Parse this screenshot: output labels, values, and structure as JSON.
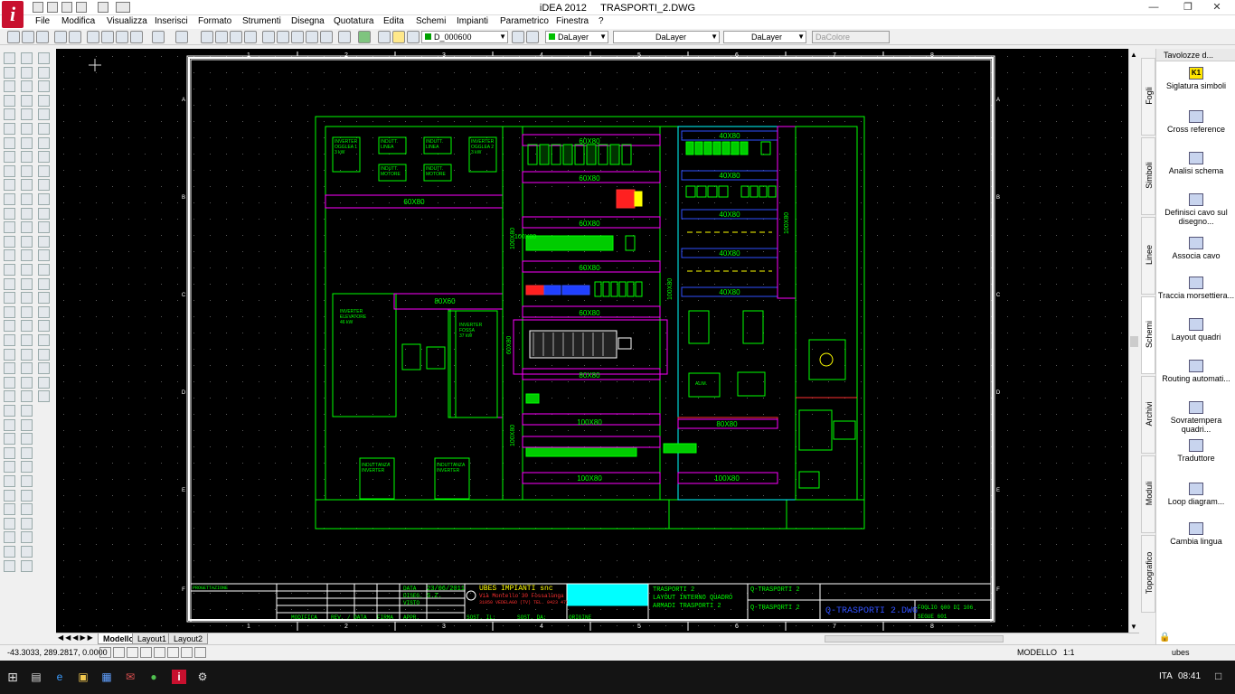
{
  "app": {
    "title": "iDEA 2012",
    "file": "TRASPORTI_2.DWG"
  },
  "menu": [
    "File",
    "Modifica",
    "Visualizza",
    "Inserisci",
    "Formato",
    "Strumenti",
    "Disegna",
    "Quotatura",
    "Edita",
    "Schemi",
    "Impianti",
    "Parametrico",
    "Finestra",
    "?"
  ],
  "toolbar": {
    "layer": "D_000600",
    "color": "DaLayer",
    "linetype": "DaLayer",
    "lineweight": "DaLayer",
    "plotcolor": "DaColore"
  },
  "drawing": {
    "cols": [
      "1",
      "2",
      "3",
      "4",
      "5",
      "6",
      "7",
      "8"
    ],
    "rows": [
      "A",
      "B",
      "C",
      "D",
      "E",
      "F"
    ],
    "left_labels": [
      "INVERTER\nOGGLEA 1\n3 kW",
      "INDUTT.\nLINEA",
      "INDUTT.\nLINEA",
      "INVERTER\nOGGLEA 2\n3 kW",
      "INDUTT.\nMOTORE",
      "INDUTT.\nMOTORE"
    ],
    "plates": [
      "60X80",
      "60X80",
      "60X80",
      "60X80",
      "60X80",
      "80X60",
      "40X80",
      "40X80",
      "40X80",
      "40X80",
      "40X80",
      "80X80",
      "80X80",
      "100X80",
      "100X80",
      "100X80",
      "100X80",
      "100X80",
      "60X80",
      "100X80",
      "100X80"
    ],
    "inv_elev": "INVERTER\nELEVATORE\n46 kW",
    "inv_fossa": "INVERTER\nFOSSA\n37 kW",
    "indutt_inv_1": "INDUTTANZA\nINVERTER",
    "indutt_inv_2": "INDUTTANZA\nINVERTER",
    "alim": "ALIM.",
    "titleblock": {
      "progettazione": "PROGETTAZIONE",
      "data_label": "DATA",
      "data_value": "23/06/2011",
      "diseg_label": "DISEG.",
      "diseg_value": "S.Z.",
      "visto_label": "VISTO",
      "appr_label": "APPR.",
      "modifica": "MODIFICA",
      "rev": "REV. / DATA",
      "firma": "FIRMA",
      "company": "UBES IMPIANTI snc",
      "address1": "Via Montello 30  Fossalunga",
      "address2": "31050 VEDELAGO (TV) TEL. 0423 476138",
      "sost_il": "SOST. IL:",
      "sost_da": "SOST. DA:",
      "origine": "ORIGINE",
      "desc1": "TRASPORTI 2",
      "desc2": "LAYOUT INTERNO QUADRO",
      "desc3": "ARMADI TRASPORTI 2",
      "ref1": "Q-TRASPORTI 2",
      "ref2": "Q-TRASPORTI 2",
      "filename": "Q-TRASPORTI 2.DWG",
      "foglio": "FOGLIO 600 DI 106",
      "segue": "SEGUE 601"
    }
  },
  "layout_tabs": [
    "Modello",
    "Layout1",
    "Layout2"
  ],
  "right_panel": {
    "title": "Tavolozze d...",
    "items": [
      {
        "label": "Siglatura simboli",
        "icon": "K1"
      },
      {
        "label": "Cross reference",
        "icon": "xr"
      },
      {
        "label": "Analisi schema",
        "icon": "an"
      },
      {
        "label": "Definisci cavo sul disegno...",
        "icon": "dc"
      },
      {
        "label": "Associa cavo",
        "icon": "ac"
      },
      {
        "label": "Traccia morsettiera...",
        "icon": "tm"
      },
      {
        "label": "Layout quadri",
        "icon": "lq"
      },
      {
        "label": "Routing automati...",
        "icon": "ra"
      },
      {
        "label": "Sovratempera quadri...",
        "icon": "sq"
      },
      {
        "label": "Traduttore",
        "icon": "tr"
      },
      {
        "label": "Loop diagram...",
        "icon": "ld"
      },
      {
        "label": "Cambia lingua",
        "icon": "cl"
      }
    ],
    "vtabs": [
      "Fogli",
      "Simboli",
      "Linee",
      "Schemi",
      "Archivi",
      "Moduli",
      "Topografico"
    ]
  },
  "status": {
    "coords": "-43.3033, 289.2817, 0.0000",
    "mode": "MODELLO",
    "scale": "1:1",
    "user": "ubes"
  },
  "taskbar": {
    "lang": "ITA",
    "time": "08:41"
  },
  "colors": {
    "frame": "#ffffff",
    "green": "#00ff00",
    "magenta": "#ff00ff",
    "cyan": "#00ffff",
    "blue": "#3050ff",
    "grid": "#5a5a5a"
  }
}
